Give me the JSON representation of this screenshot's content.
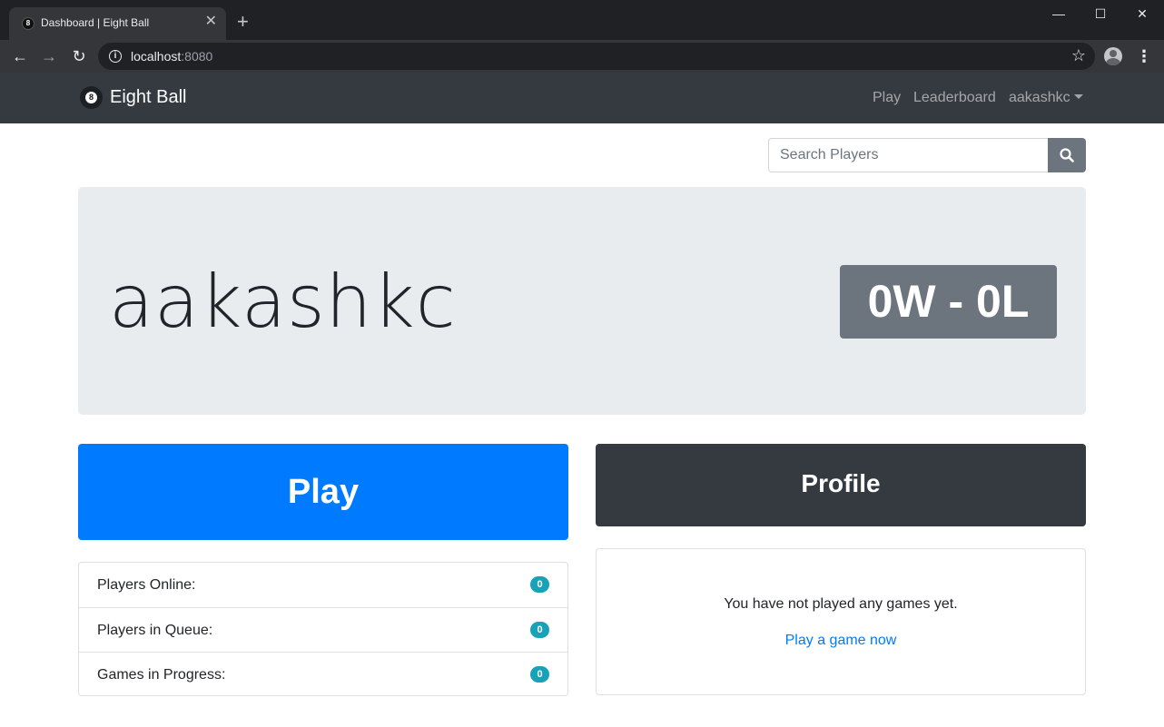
{
  "browser": {
    "tab_title": "Dashboard | Eight Ball",
    "tab_favicon": "8",
    "url_host": "localhost",
    "url_port": ":8080"
  },
  "navbar": {
    "brand": "Eight Ball",
    "brand_logo_glyph": "8",
    "links": [
      "Play",
      "Leaderboard"
    ],
    "user_menu": "aakashkc"
  },
  "search": {
    "placeholder": "Search Players"
  },
  "profile": {
    "username": "aakashkc",
    "record": "0W - 0L"
  },
  "actions": {
    "play_label": "Play",
    "profile_label": "Profile"
  },
  "stats": [
    {
      "label": "Players Online:",
      "count": "0"
    },
    {
      "label": "Players in Queue:",
      "count": "0"
    },
    {
      "label": "Games in Progress:",
      "count": "0"
    }
  ],
  "games": {
    "empty_message": "You have not played any games yet.",
    "play_link": "Play a game now"
  },
  "colors": {
    "primary": "#007bff",
    "dark": "#343a40",
    "secondary": "#6c757d",
    "info": "#17a2b8",
    "jumbotron": "#e9ecef"
  }
}
